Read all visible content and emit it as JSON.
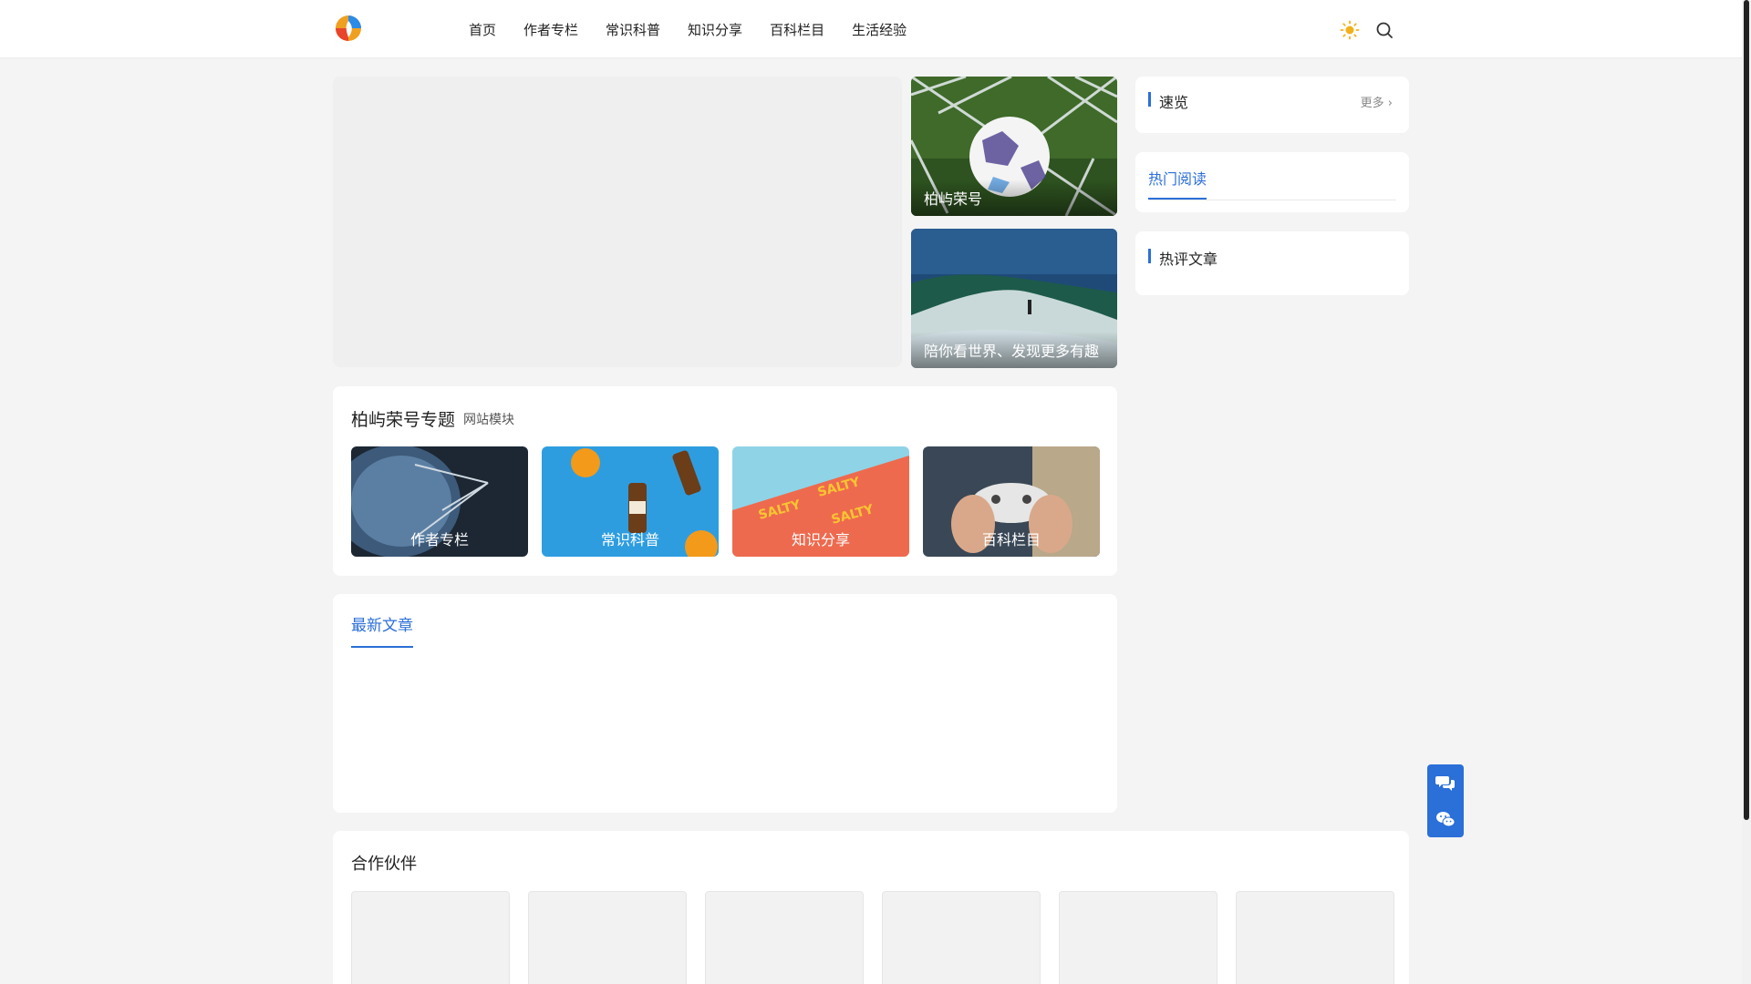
{
  "header": {
    "logo_alt": "logo",
    "nav": [
      "首页",
      "作者专栏",
      "常识科普",
      "知识分享",
      "百科栏目",
      "生活经验"
    ]
  },
  "hero": {
    "cards": [
      {
        "caption": "柏屿荣号",
        "image": "soccer-ball-in-net"
      },
      {
        "caption": "陪你看世界、发现更多有趣",
        "image": "surfer-on-wave"
      }
    ]
  },
  "sidebar": {
    "quick_view": {
      "title": "速览",
      "more": "更多"
    },
    "hot_read": {
      "tab": "热门阅读"
    },
    "hot_comments": {
      "title": "热评文章"
    }
  },
  "topics": {
    "title": "柏屿荣号专题",
    "subtitle": "网站模块",
    "items": [
      "作者专栏",
      "常识科普",
      "知识分享",
      "百科栏目"
    ]
  },
  "latest": {
    "tab": "最新文章"
  },
  "partners": {
    "title": "合作伙伴",
    "count": 6
  },
  "colors": {
    "accent": "#2b6fd8",
    "background": "#f4f4f4"
  }
}
